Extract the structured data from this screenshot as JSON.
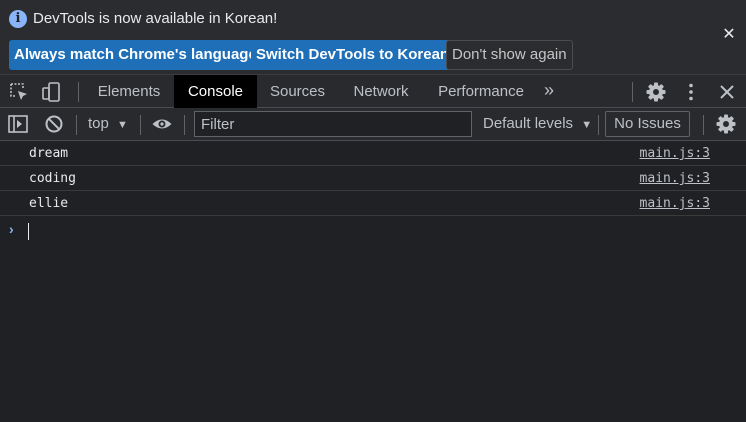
{
  "infobar": {
    "message": "DevTools is now available in Korean!",
    "icon": "info-icon",
    "buttons": [
      {
        "label": "Always match Chrome's language",
        "style": "primary"
      },
      {
        "label": "Switch DevTools to Korean",
        "style": "primary"
      },
      {
        "label": "Don't show again",
        "style": "secondary"
      }
    ],
    "close_icon": "close-icon"
  },
  "tabbar": {
    "tabs": [
      {
        "label": "Elements",
        "active": false
      },
      {
        "label": "Console",
        "active": true
      },
      {
        "label": "Sources",
        "active": false
      },
      {
        "label": "Network",
        "active": false
      },
      {
        "label": "Performance",
        "active": false
      }
    ],
    "more_label": "»",
    "icons": [
      "inspect-element-icon",
      "device-toolbar-icon",
      "settings-icon",
      "kebab-menu-icon",
      "close-icon"
    ]
  },
  "console_toolbar": {
    "context": "top",
    "filter_placeholder": "Filter",
    "levels_label": "Default levels",
    "issues_label": "No Issues",
    "icons": [
      "sidebar-toggle-icon",
      "clear-console-icon",
      "eye-icon",
      "console-settings-icon"
    ]
  },
  "console": {
    "messages": [
      {
        "text": "dream",
        "source": "main.js:3"
      },
      {
        "text": "coding",
        "source": "main.js:3"
      },
      {
        "text": "ellie",
        "source": "main.js:3"
      }
    ],
    "prompt_symbol": "›"
  },
  "colors": {
    "background": "#202124",
    "accent_button": "#1e6fb8",
    "prompt_arrow": "#8ab4f8",
    "active_tab": "#000000"
  }
}
